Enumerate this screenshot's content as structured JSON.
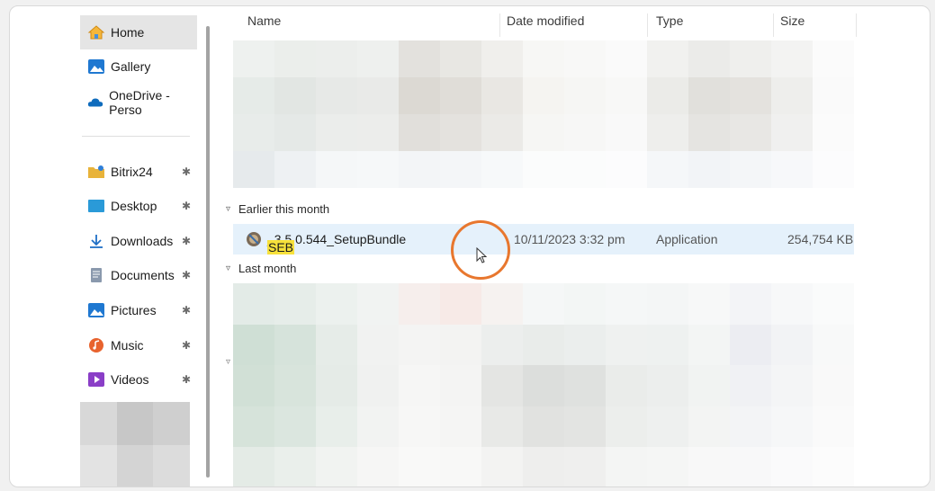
{
  "sidebar": {
    "items": [
      {
        "label": "Home",
        "icon": "home-icon",
        "selected": true
      },
      {
        "label": "Gallery",
        "icon": "gallery-icon"
      },
      {
        "label": "OneDrive - Perso",
        "icon": "onedrive-icon"
      },
      {
        "label": "Bitrix24",
        "icon": "folder-icon",
        "pinned": true
      },
      {
        "label": "Desktop",
        "icon": "desktop-icon",
        "pinned": true
      },
      {
        "label": "Downloads",
        "icon": "downloads-icon",
        "pinned": true
      },
      {
        "label": "Documents",
        "icon": "documents-icon",
        "pinned": true
      },
      {
        "label": "Pictures",
        "icon": "pictures-icon",
        "pinned": true
      },
      {
        "label": "Music",
        "icon": "music-icon",
        "pinned": true
      },
      {
        "label": "Videos",
        "icon": "videos-icon",
        "pinned": true
      }
    ]
  },
  "columns": {
    "name": "Name",
    "date": "Date modified",
    "type": "Type",
    "size": "Size"
  },
  "groups": {
    "earlier": "Earlier this month",
    "last": "Last month"
  },
  "file": {
    "name_highlight": "SEB",
    "name_rest": "_3.5.0.544_SetupBundle",
    "date": "10/11/2023 3:32 pm",
    "type": "Application",
    "size": "254,754 KB"
  },
  "colors": {
    "selection": "#e5f1fb",
    "highlight": "#f7e13b",
    "focus_ring": "#e8772e"
  }
}
